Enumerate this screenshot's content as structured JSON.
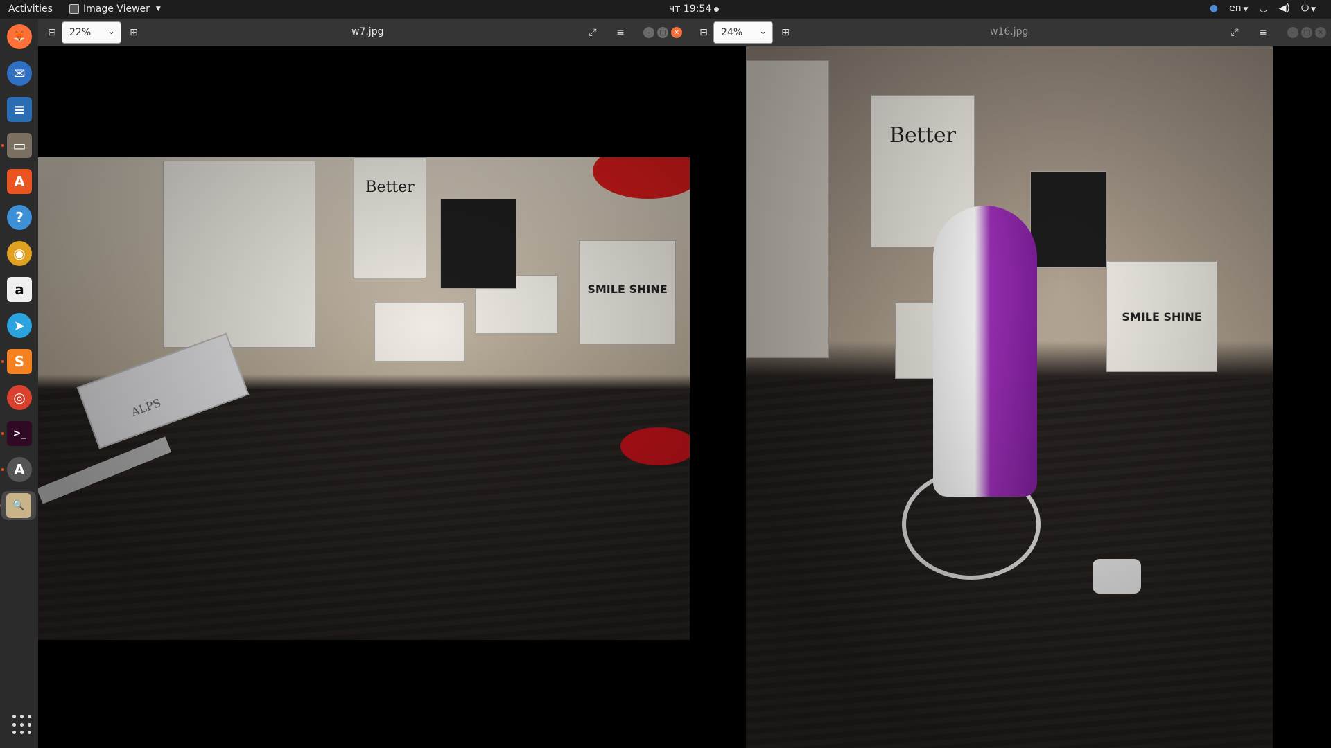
{
  "topbar": {
    "activities": "Activities",
    "app_name": "Image Viewer",
    "clock": "чт 19:54",
    "lang": "en"
  },
  "dock": {
    "items": [
      {
        "name": "firefox-icon",
        "glyph": "🦊",
        "color": "#ff7139"
      },
      {
        "name": "thunderbird-icon",
        "glyph": "✉",
        "color": "#2f6fc4"
      },
      {
        "name": "libreoffice-writer-icon",
        "glyph": "≡",
        "color": "#2a6db5"
      },
      {
        "name": "files-icon",
        "glyph": "▭",
        "color": "#7a6f60"
      },
      {
        "name": "software-center-icon",
        "glyph": "A",
        "color": "#e95420"
      },
      {
        "name": "help-icon",
        "glyph": "?",
        "color": "#3d8fd6"
      },
      {
        "name": "rhythmbox-icon",
        "glyph": "◉",
        "color": "#e0a020"
      },
      {
        "name": "amazon-icon",
        "glyph": "a",
        "color": "#f0f0f0"
      },
      {
        "name": "telegram-icon",
        "glyph": "➤",
        "color": "#2aa3de"
      },
      {
        "name": "sublime-text-icon",
        "glyph": "S",
        "color": "#f58220"
      },
      {
        "name": "chrome-icon",
        "glyph": "◎",
        "color": "#d9402d"
      },
      {
        "name": "terminal-icon",
        "glyph": ">_",
        "color": "#300a24"
      },
      {
        "name": "software-updater-icon",
        "glyph": "A",
        "color": "#555"
      },
      {
        "name": "image-viewer-icon",
        "glyph": "🔍",
        "color": "#c9b48a"
      }
    ]
  },
  "window1": {
    "zoom": "22%",
    "title": "w7.jpg"
  },
  "window2": {
    "zoom": "24%",
    "title": "w16.jpg"
  },
  "photo1_text": {
    "book_title": "ALPS",
    "poster_text": "Better",
    "sticker": "SMILE SHINE"
  },
  "photo2_text": {
    "poster_text": "Better",
    "sticker": "SMILE SHINE"
  },
  "colors": {
    "accent": "#e95420",
    "panel": "#1d1d1d",
    "dock": "#2b2b2b",
    "header": "#353535"
  }
}
